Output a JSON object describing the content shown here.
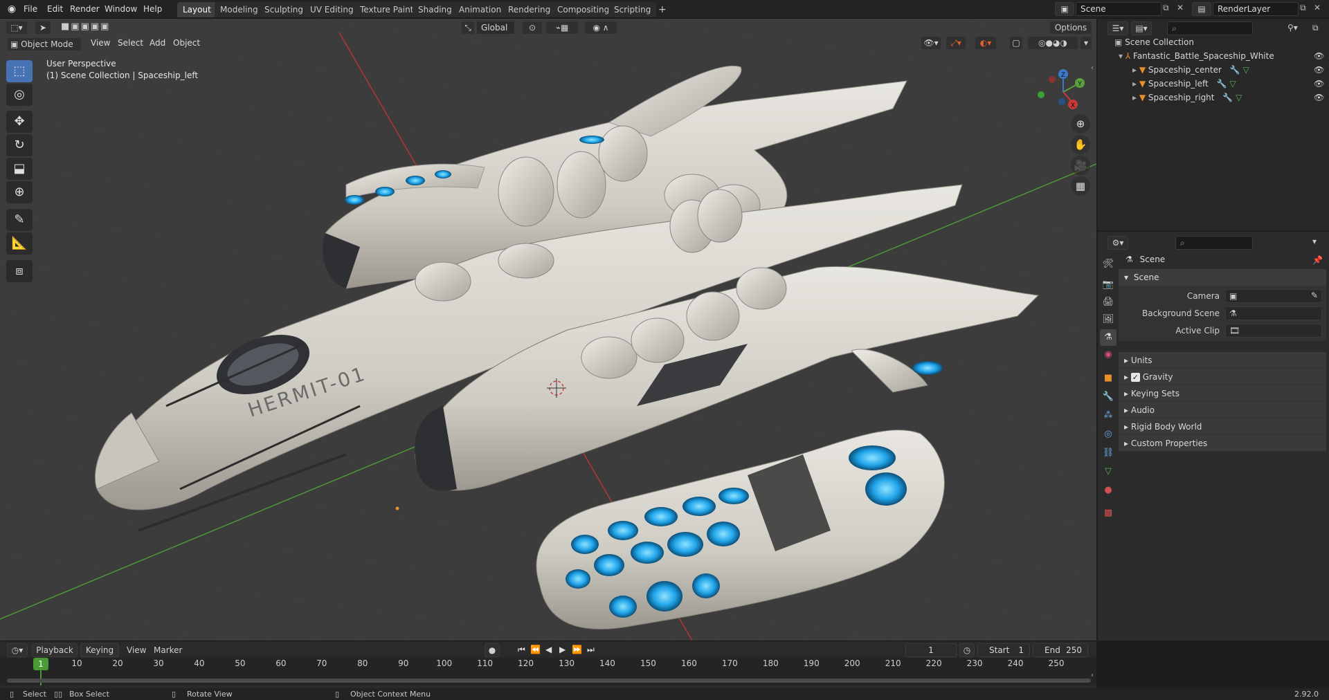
{
  "topbar": {
    "menus": [
      "File",
      "Edit",
      "Render",
      "Window",
      "Help"
    ],
    "workspaces": [
      "Layout",
      "Modeling",
      "Sculpting",
      "UV Editing",
      "Texture Paint",
      "Shading",
      "Animation",
      "Rendering",
      "Compositing",
      "Scripting"
    ],
    "active_workspace": "Layout",
    "add_tab": "+",
    "scene_name": "Scene",
    "view_layer": "RenderLayer"
  },
  "viewport_header": {
    "mode": "Object Mode",
    "menus": [
      "View",
      "Select",
      "Add",
      "Object"
    ],
    "transform_orientation": "Global",
    "options_label": "Options"
  },
  "viewport": {
    "perspective_label": "User Perspective",
    "context_label": "(1) Scene Collection | Spaceship_left",
    "ship_text": "HERMIT-01",
    "gizmo_axes": [
      "X",
      "Y",
      "Z"
    ]
  },
  "outliner": {
    "root": "Scene Collection",
    "collection": "Fantastic_Battle_Spaceship_White",
    "objects": [
      "Spaceship_center",
      "Spaceship_left",
      "Spaceship_right"
    ]
  },
  "properties": {
    "header": "Scene",
    "section": "Scene",
    "fields": [
      {
        "label": "Camera",
        "value": ""
      },
      {
        "label": "Background Scene",
        "value": ""
      },
      {
        "label": "Active Clip",
        "value": ""
      }
    ],
    "panels": [
      "Units",
      "Gravity",
      "Keying Sets",
      "Audio",
      "Rigid Body World",
      "Custom Properties"
    ],
    "gravity_checked": true
  },
  "timeline": {
    "menus": [
      "Playback",
      "Keying",
      "View",
      "Marker"
    ],
    "current_frame": "1",
    "start_label": "Start",
    "start": "1",
    "end_label": "End",
    "end": "250",
    "ticks": [
      "1",
      "10",
      "20",
      "30",
      "40",
      "50",
      "60",
      "70",
      "80",
      "90",
      "100",
      "110",
      "120",
      "130",
      "140",
      "150",
      "160",
      "170",
      "180",
      "190",
      "200",
      "210",
      "220",
      "230",
      "240",
      "250"
    ]
  },
  "statusbar": {
    "select": "Select",
    "box_select": "Box Select",
    "rotate_view": "Rotate View",
    "context_menu": "Object Context Menu",
    "version": "2.92.0"
  },
  "colors": {
    "accent": "#4772b3",
    "active_tool": "#c8502a",
    "x_axis": "#c83a3a",
    "y_axis": "#5aa03a",
    "emissive": "#2aa8e8"
  }
}
